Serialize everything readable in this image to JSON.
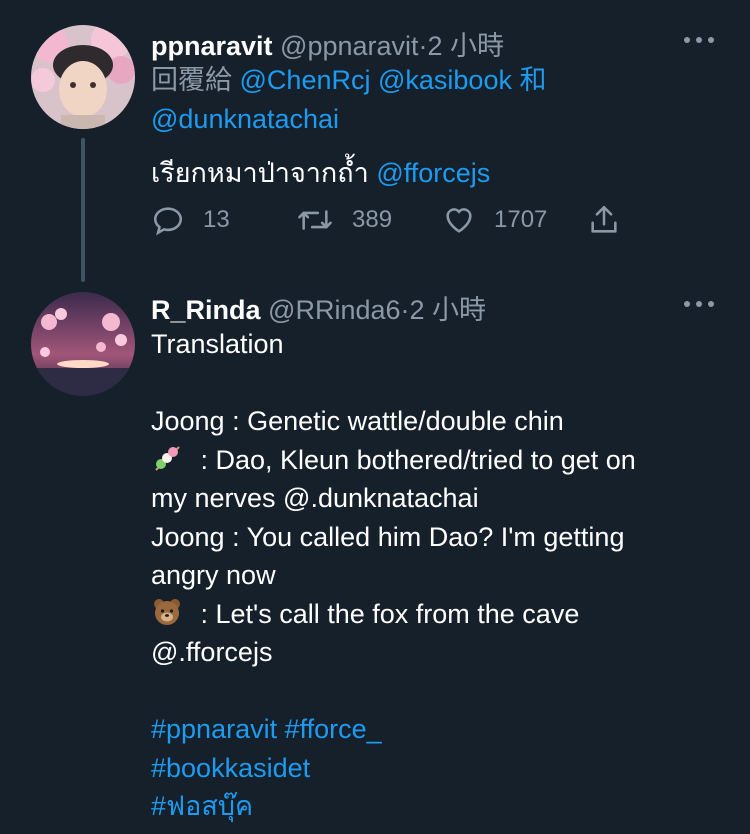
{
  "tweet1": {
    "display_name": "ppnaravit",
    "handle": "@ppnaravit",
    "separator": "·",
    "time": "2 小時",
    "reply_prefix": "回覆給",
    "reply_user1": "@ChenRcj",
    "reply_user2": "@kasibook",
    "reply_and": "和",
    "reply_user3": "@dunknatachai",
    "text": "เรียกหมาป่าจากถ้ำ",
    "mention": "@fforcejs",
    "replies": "13",
    "retweets": "389",
    "likes": "1707"
  },
  "tweet2": {
    "display_name": "R_Rinda",
    "handle": "@RRinda6",
    "separator": "·",
    "time": "2 小時",
    "lines": {
      "l1": "Translation",
      "l2": "Joong : Genetic wattle/double chin",
      "l3": " : Dao, Kleun bothered/tried to get on",
      "l4": "my nerves @.dunknatachai",
      "l5": "Joong : You called him Dao? I'm getting",
      "l6": "angry now",
      "l7": " : Let's call the fox from the cave",
      "l8": "@.fforcejs"
    },
    "hashtags": {
      "h1": "#ppnaravit",
      "h2": "#fforce_",
      "h3": "#bookkasidet",
      "h4": "#ฟอสบุ๊ค"
    }
  },
  "icons": {
    "reply": "reply-icon",
    "retweet": "retweet-icon",
    "like": "heart-icon",
    "share": "share-icon",
    "more": "more-icon",
    "dango": "dango-emoji-icon",
    "bear": "bear-emoji-icon"
  },
  "colors": {
    "background": "#15202b",
    "link": "#1d9bf0",
    "muted": "#8b98a5"
  }
}
